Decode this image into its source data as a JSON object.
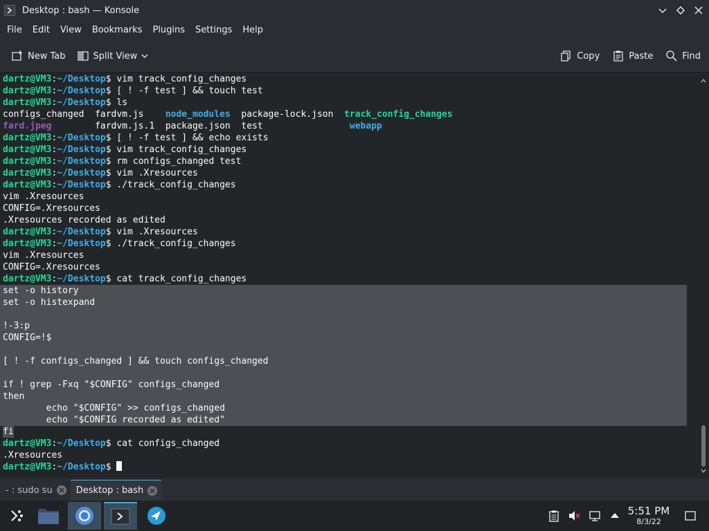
{
  "window": {
    "title": "Desktop : bash — Konsole"
  },
  "menu": [
    "File",
    "Edit",
    "View",
    "Bookmarks",
    "Plugins",
    "Settings",
    "Help"
  ],
  "toolbar": {
    "new_tab": "New Tab",
    "split_view": "Split View",
    "copy": "Copy",
    "paste": "Paste",
    "find": "Find"
  },
  "prompt": {
    "user": "dartz@VM3",
    "path": "~/Desktop"
  },
  "terminal": {
    "lines": [
      {
        "type": "prompt",
        "cmd": "vim track_config_changes"
      },
      {
        "type": "prompt",
        "cmd": "[ ! -f test ] && touch test"
      },
      {
        "type": "prompt",
        "cmd": "ls"
      },
      {
        "type": "ls",
        "cols": [
          {
            "text": "configs_changed  ",
            "cls": ""
          },
          {
            "text": "fardvm.js    ",
            "cls": ""
          },
          {
            "text": "node_modules",
            "cls": "c-dir"
          },
          {
            "text": "  package-lock.json  ",
            "cls": ""
          },
          {
            "text": "track_config_changes",
            "cls": "c-exec"
          }
        ]
      },
      {
        "type": "ls",
        "cols": [
          {
            "text": "fard.jpeg",
            "cls": "c-img"
          },
          {
            "text": "        fardvm.js.1  package.json  test                ",
            "cls": ""
          },
          {
            "text": "webapp",
            "cls": "c-dir"
          }
        ]
      },
      {
        "type": "prompt",
        "cmd": "[ ! -f test ] && echo exists"
      },
      {
        "type": "prompt",
        "cmd": "vim track_config_changes"
      },
      {
        "type": "prompt",
        "cmd": "rm configs_changed test"
      },
      {
        "type": "prompt",
        "cmd": "vim .Xresources"
      },
      {
        "type": "prompt",
        "cmd": "./track_config_changes"
      },
      {
        "type": "out",
        "text": "vim .Xresources"
      },
      {
        "type": "out",
        "text": "CONFIG=.Xresources"
      },
      {
        "type": "out",
        "text": ".Xresources recorded as edited"
      },
      {
        "type": "prompt",
        "cmd": "vim .Xresources"
      },
      {
        "type": "prompt",
        "cmd": "./track_config_changes"
      },
      {
        "type": "out",
        "text": "vim .Xresources"
      },
      {
        "type": "out",
        "text": "CONFIG=.Xresources"
      },
      {
        "type": "prompt",
        "cmd": "cat track_config_changes"
      },
      {
        "type": "sel",
        "text": "set -o history"
      },
      {
        "type": "sel",
        "text": "set -o histexpand"
      },
      {
        "type": "sel",
        "text": ""
      },
      {
        "type": "sel",
        "text": "!-3:p"
      },
      {
        "type": "sel",
        "text": "CONFIG=!$"
      },
      {
        "type": "sel",
        "text": ""
      },
      {
        "type": "sel",
        "text": "[ ! -f configs_changed ] && touch configs_changed"
      },
      {
        "type": "sel",
        "text": ""
      },
      {
        "type": "sel",
        "text": "if ! grep -Fxq \"$CONFIG\" configs_changed"
      },
      {
        "type": "sel",
        "text": "then"
      },
      {
        "type": "sel",
        "text": "        echo \"$CONFIG\" >> configs_changed"
      },
      {
        "type": "sel",
        "text": "        echo \"$CONFIG recorded as edited\""
      },
      {
        "type": "sellast",
        "text": "fi"
      },
      {
        "type": "prompt",
        "cmd": "cat configs_changed"
      },
      {
        "type": "out",
        "text": ".Xresources"
      },
      {
        "type": "cursor",
        "cmd": ""
      }
    ]
  },
  "tabs": [
    {
      "label": "- : sudo su",
      "active": false
    },
    {
      "label": "Desktop : bash",
      "active": true
    }
  ],
  "taskbar": {
    "apps": [
      "app-launcher",
      "file-manager",
      "chromium",
      "konsole",
      "browser"
    ]
  },
  "clock": {
    "time": "5:51 PM",
    "date": "8/3/22"
  },
  "colors": {
    "accent": "#3daee9",
    "prompt_user": "#1cdc9a",
    "selection": "#4c4f53"
  }
}
